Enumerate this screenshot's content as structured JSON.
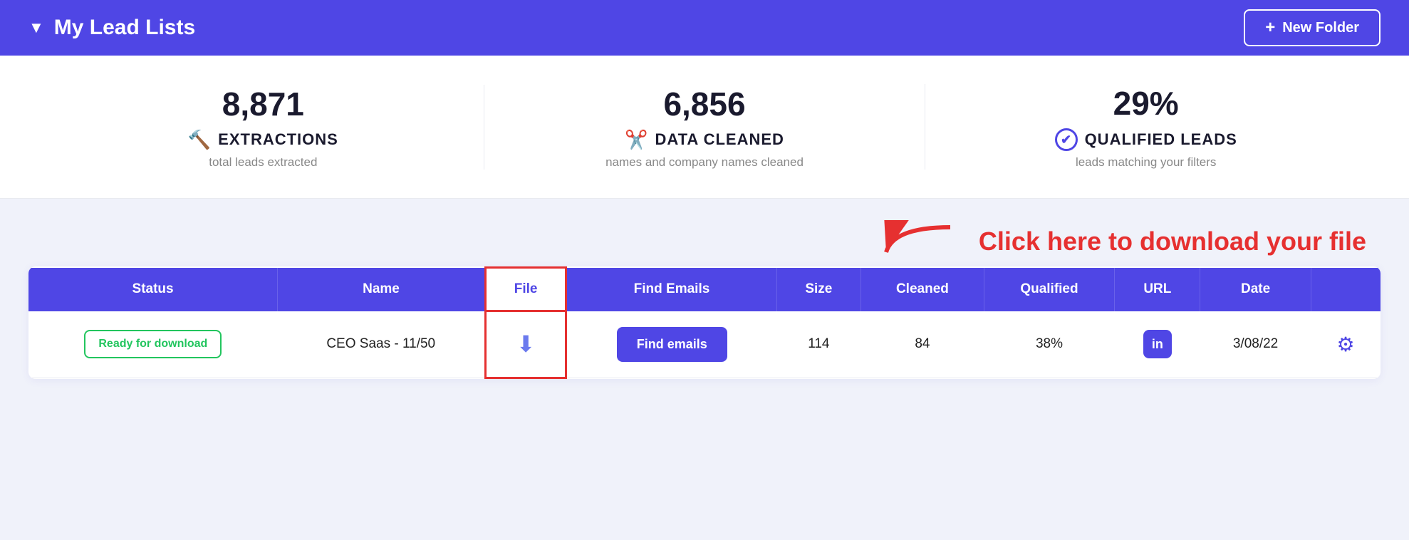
{
  "header": {
    "arrow": "▼",
    "title": "My Lead Lists",
    "new_folder_btn": "New Folder",
    "plus_icon": "+"
  },
  "stats": [
    {
      "number": "8,871",
      "icon": "🔨",
      "label": "EXTRACTIONS",
      "sub": "total leads extracted"
    },
    {
      "number": "6,856",
      "icon": "✂️",
      "label": "DATA CLEANED",
      "sub": "names and company names cleaned"
    },
    {
      "number": "29%",
      "icon": "✔",
      "label": "QUALIFIED LEADS",
      "sub": "leads matching your filters"
    }
  ],
  "annotation": {
    "text": "Click here to download your file"
  },
  "table": {
    "columns": [
      "Status",
      "Name",
      "File",
      "Find Emails",
      "Size",
      "Cleaned",
      "Qualified",
      "URL",
      "Date",
      ""
    ],
    "rows": [
      {
        "status": "Ready for download",
        "name": "CEO Saas - 11/50",
        "file_icon": "⬇",
        "find_emails_btn": "Find emails",
        "size": "114",
        "cleaned": "84",
        "qualified": "38%",
        "url_icon": "in",
        "date": "3/08/22",
        "gear_icon": "⚙"
      }
    ]
  }
}
